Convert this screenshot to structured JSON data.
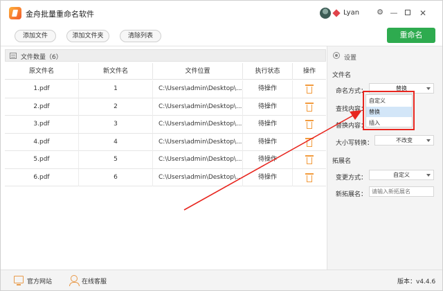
{
  "app": {
    "title": "金舟批量重命名软件",
    "username": "Lyan",
    "version": "版本：v4.4.6"
  },
  "window_controls": {
    "settings": "⚙",
    "minimize": "—",
    "close": "✕"
  },
  "toolbar": {
    "add_file": "添加文件",
    "add_folder": "添加文件夹",
    "clear_list": "清除列表",
    "rename": "重命名"
  },
  "file_list": {
    "count_label": "文件数量（6）",
    "columns": [
      "原文件名",
      "新文件名",
      "文件位置",
      "执行状态",
      "操作"
    ],
    "rows": [
      {
        "original": "1.pdf",
        "new": "1",
        "location": "C:\\Users\\admin\\Desktop\\...",
        "status": "待操作"
      },
      {
        "original": "2.pdf",
        "new": "2",
        "location": "C:\\Users\\admin\\Desktop\\...",
        "status": "待操作"
      },
      {
        "original": "3.pdf",
        "new": "3",
        "location": "C:\\Users\\admin\\Desktop\\...",
        "status": "待操作"
      },
      {
        "original": "4.pdf",
        "new": "4",
        "location": "C:\\Users\\admin\\Desktop\\...",
        "status": "待操作"
      },
      {
        "original": "5.pdf",
        "new": "5",
        "location": "C:\\Users\\admin\\Desktop\\...",
        "status": "待操作"
      },
      {
        "original": "6.pdf",
        "new": "6",
        "location": "C:\\Users\\admin\\Desktop\\...",
        "status": "待操作"
      }
    ]
  },
  "settings": {
    "title": "设置",
    "filename_section": "文件名",
    "naming_method_label": "命名方式：",
    "naming_method_value": "替换",
    "naming_options": [
      "自定义",
      "替换",
      "插入"
    ],
    "find_label": "查找内容：",
    "replace_label": "替换内容：",
    "case_label": "大小写转换：",
    "case_value": "不改变",
    "extension_section": "拓展名",
    "change_method_label": "变更方式：",
    "change_method_value": "自定义",
    "new_ext_label": "新拓展名：",
    "new_ext_placeholder": "请输入新拓展名"
  },
  "statusbar": {
    "website": "官方网站",
    "service": "在线客服"
  },
  "colors": {
    "accent_green": "#2eab4f",
    "annotation_red": "#e8261f",
    "trash_orange": "#f29a3b"
  }
}
